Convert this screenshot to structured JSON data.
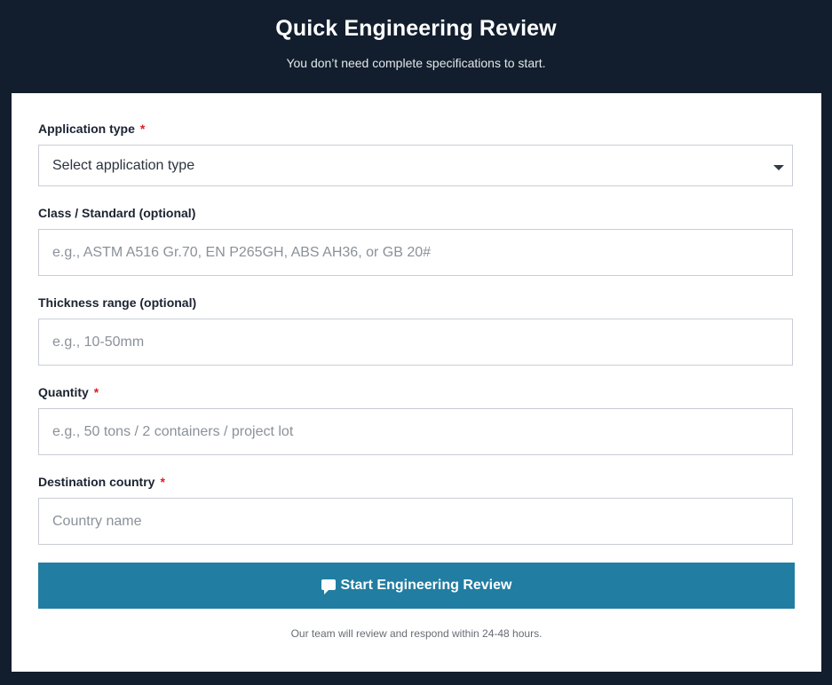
{
  "header": {
    "title": "Quick Engineering Review",
    "subtitle": "You don’t need complete specifications to start."
  },
  "form": {
    "application_type": {
      "label": "Application type",
      "required_mark": "*",
      "selected": "Select application type"
    },
    "class_standard": {
      "label": "Class / Standard (optional)",
      "placeholder": "e.g., ASTM A516 Gr.70, EN P265GH, ABS AH36, or GB 20#"
    },
    "thickness_range": {
      "label": "Thickness range (optional)",
      "placeholder": "e.g., 10-50mm"
    },
    "quantity": {
      "label": "Quantity",
      "required_mark": "*",
      "placeholder": "e.g., 50 tons / 2 containers / project lot"
    },
    "destination_country": {
      "label": "Destination country",
      "required_mark": "*",
      "placeholder": "Country name"
    },
    "submit": {
      "label": "Start Engineering Review",
      "icon": "chat-icon"
    },
    "footnote": "Our team will review and respond within 24-48 hours."
  },
  "colors": {
    "background": "#121e2d",
    "card": "#ffffff",
    "button": "#217da1",
    "required": "#d81f26"
  }
}
